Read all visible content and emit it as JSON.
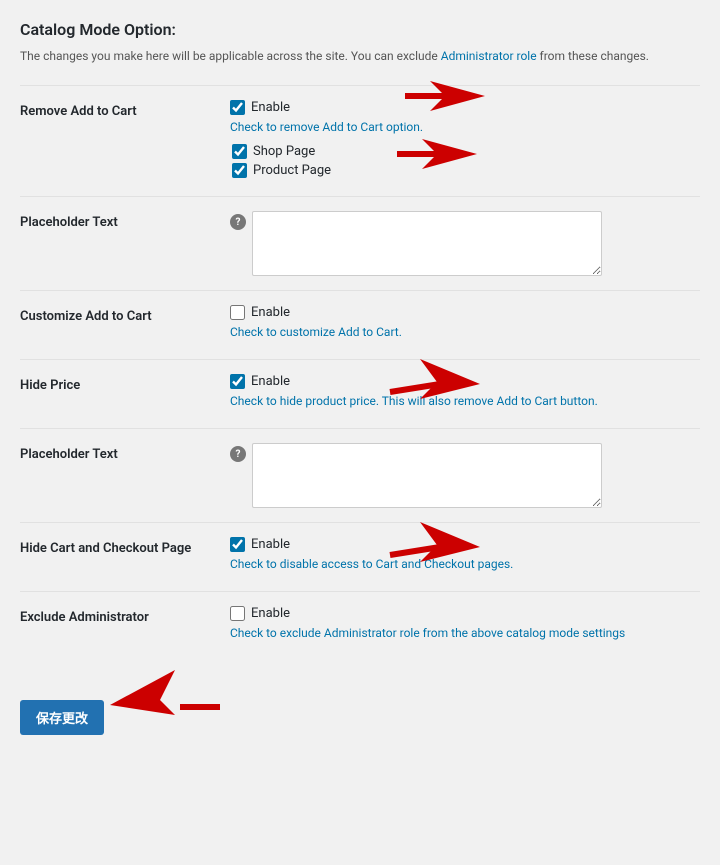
{
  "page": {
    "title": "Catalog Mode Option:",
    "intro": "The changes you make here will be applicable across the site. You can exclude Administrator role from these changes.",
    "intro_link_text": "Administrator role",
    "intro_link_href": "#"
  },
  "sections": [
    {
      "id": "remove-add-to-cart",
      "label": "Remove Add to Cart",
      "enable_checked": true,
      "enable_label": "Enable",
      "help_text": "Check to remove Add to Cart option.",
      "has_sub_options": true,
      "sub_options": [
        {
          "id": "shop-page",
          "label": "Shop Page",
          "checked": true
        },
        {
          "id": "product-page",
          "label": "Product Page",
          "checked": true
        }
      ]
    },
    {
      "id": "placeholder-text-1",
      "label": "Placeholder Text",
      "has_help_icon": true,
      "has_textarea": true,
      "textarea_placeholder": ""
    },
    {
      "id": "customize-add-to-cart",
      "label": "Customize Add to Cart",
      "enable_checked": false,
      "enable_label": "Enable",
      "help_text": "Check to customize Add to Cart."
    },
    {
      "id": "hide-price",
      "label": "Hide Price",
      "enable_checked": true,
      "enable_label": "Enable",
      "help_text": "Check to hide product price. This will also remove Add to Cart button."
    },
    {
      "id": "placeholder-text-2",
      "label": "Placeholder Text",
      "has_help_icon": true,
      "has_textarea": true,
      "textarea_placeholder": ""
    },
    {
      "id": "hide-cart-checkout",
      "label": "Hide Cart and Checkout Page",
      "enable_checked": true,
      "enable_label": "Enable",
      "help_text": "Check to disable access to Cart and Checkout pages."
    },
    {
      "id": "exclude-administrator",
      "label": "Exclude Administrator",
      "enable_checked": false,
      "enable_label": "Enable",
      "help_text": "Check to exclude Administrator role from the above catalog mode settings"
    }
  ],
  "save_button": {
    "label": "保存更改"
  }
}
